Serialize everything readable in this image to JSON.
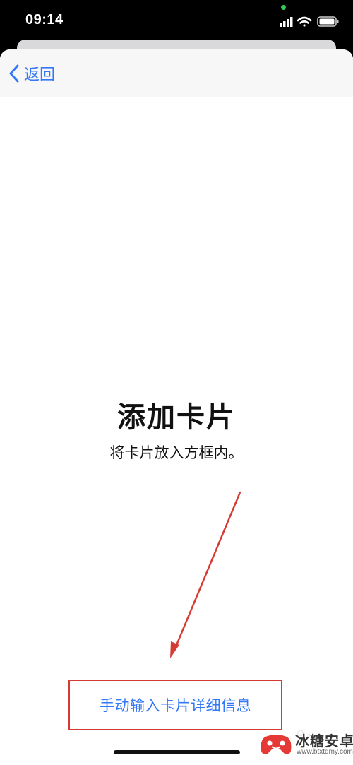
{
  "status_bar": {
    "time": "09:14",
    "icons": [
      "signal-icon",
      "wifi-icon",
      "battery-icon"
    ],
    "privacy_dot_color": "#34c759"
  },
  "nav": {
    "back_label": "返回",
    "back_icon": "chevron-left-icon",
    "accent_color": "#3478f6"
  },
  "main": {
    "title": "添加卡片",
    "subtitle": "将卡片放入方框内。"
  },
  "manual_entry": {
    "label": "手动输入卡片详细信息",
    "highlight_color": "#d63b33"
  },
  "watermark": {
    "name": "冰糖安卓网",
    "url": "www.btxtdmy.com",
    "faint_text": "⊙ 。"
  }
}
